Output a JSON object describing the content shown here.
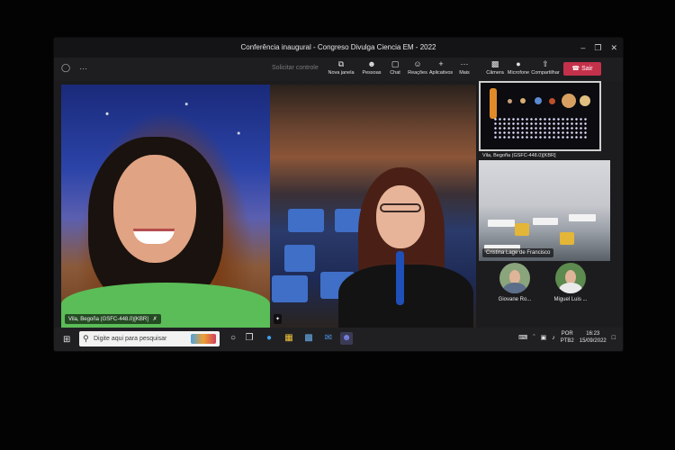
{
  "window": {
    "title": "Conferência inaugural - Congreso Divulga Ciencia EM - 2022"
  },
  "toolbar": {
    "request_control": "Solicitar controle",
    "buttons": [
      {
        "label": "Nova janela",
        "icon": "new-window-icon"
      },
      {
        "label": "Pessoas",
        "icon": "people-icon"
      },
      {
        "label": "Chat",
        "icon": "chat-icon"
      },
      {
        "label": "Reações",
        "icon": "reactions-icon"
      },
      {
        "label": "Aplicativos",
        "icon": "add-apps-icon"
      },
      {
        "label": "Mais",
        "icon": "more-icon"
      },
      {
        "label": "Câmera",
        "icon": "camera-icon"
      },
      {
        "label": "Microfone",
        "icon": "microphone-icon"
      },
      {
        "label": "Compartilhar",
        "icon": "share-screen-icon"
      }
    ],
    "leave_label": "Sair"
  },
  "tiles": {
    "main_left_name": "Vila, Begoña (GSFC-448.0)[KBR]",
    "solar_system_name": "Vila, Begoña (GSFC-448.0)[KBR]",
    "classroom_name": "Cristina Lage de Francisco",
    "participants": [
      {
        "name": "Giovane Ro..."
      },
      {
        "name": "Miguel Luis ..."
      }
    ]
  },
  "taskbar": {
    "search_placeholder": "Digite aqui para pesquisar",
    "language": [
      "POR",
      "PTB2"
    ],
    "time": "16:23",
    "date": "15/09/2022"
  }
}
